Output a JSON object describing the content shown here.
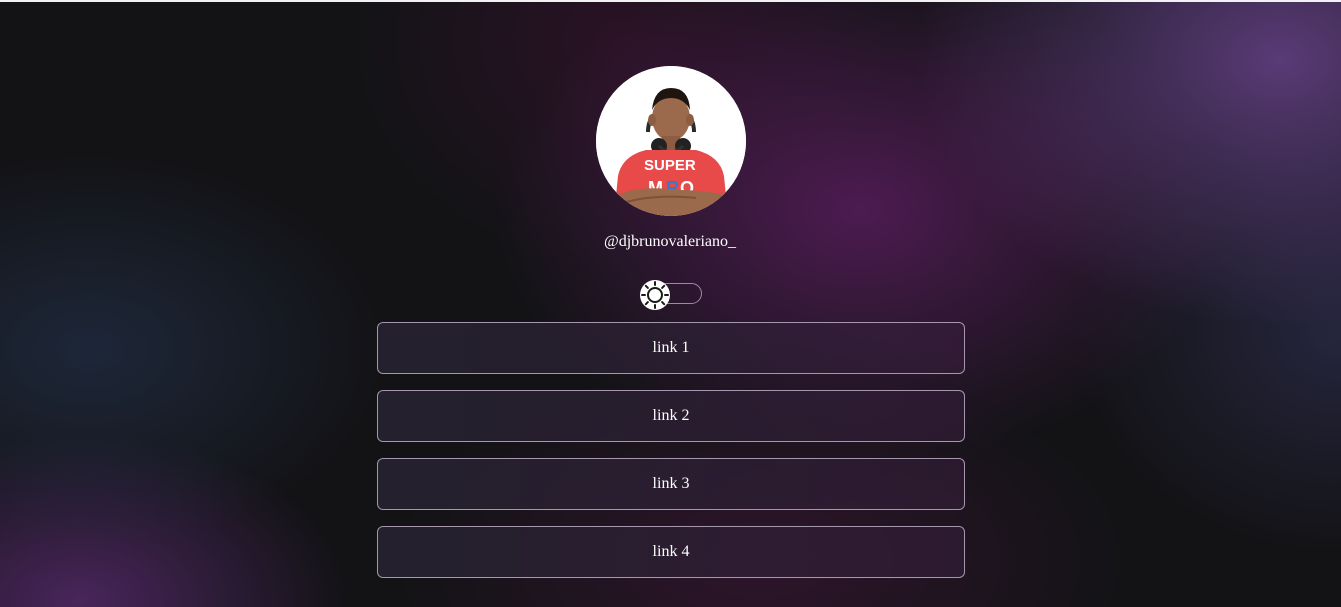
{
  "profile": {
    "username": "@djbrunovaleriano_",
    "avatar_alt": "avatar"
  },
  "theme_toggle": {
    "icon": "sun-icon",
    "state": "light"
  },
  "links": [
    {
      "label": "link 1"
    },
    {
      "label": "link 2"
    },
    {
      "label": "link 3"
    },
    {
      "label": "link 4"
    }
  ],
  "colors": {
    "background": "#131316",
    "accent_purple": "#6a2a78",
    "button_border": "#a597ad",
    "text": "#ffffff"
  }
}
